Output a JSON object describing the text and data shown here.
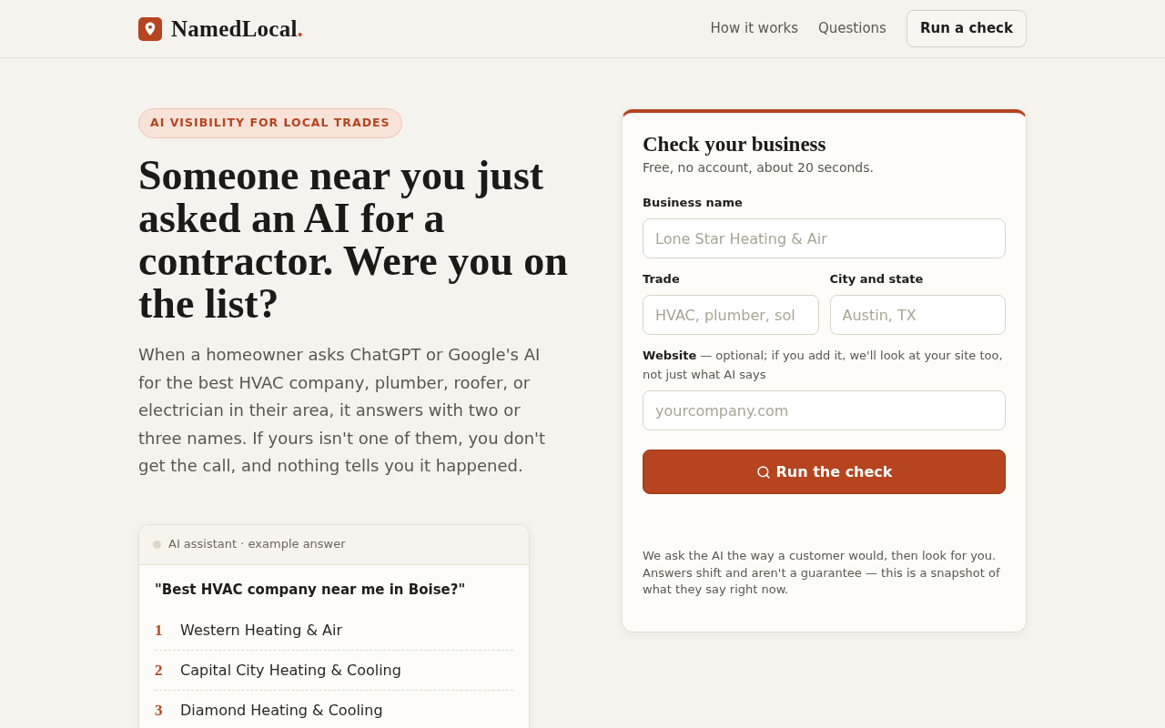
{
  "header": {
    "logo": {
      "name": "NamedLocal",
      "accent": "."
    },
    "nav": [
      {
        "label": "How it works"
      },
      {
        "label": "Questions"
      }
    ],
    "cta": "Run a check"
  },
  "hero": {
    "badge": "AI VISIBILITY FOR LOCAL TRADES",
    "title": "Someone near you just asked an AI for a contractor. Were you on the list?",
    "body": "When a homeowner asks ChatGPT or Google's AI for the best HVAC company, plumber, roofer, or electrician in their area, it answers with two or three names. If yours isn't one of them, you don't get the call, and nothing tells you it happened.",
    "example": {
      "header": "AI assistant · example answer",
      "question": "\"Best HVAC company near me in Boise?\"",
      "answers": [
        {
          "rank": "1",
          "name": "Western Heating & Air"
        },
        {
          "rank": "2",
          "name": "Capital City Heating & Cooling"
        },
        {
          "rank": "3",
          "name": "Diamond Heating & Cooling"
        }
      ]
    }
  },
  "form": {
    "title": "Check your business",
    "subtitle": "Free, no account, about 20 seconds.",
    "rows": [
      [
        {
          "label": "Business name",
          "placeholder": "Lone Star Heating & Air"
        }
      ],
      [
        {
          "label": "Trade",
          "placeholder": "HVAC, plumber, sol"
        },
        {
          "label": "City and state",
          "placeholder": "Austin, TX"
        }
      ],
      [
        {
          "label": "Website",
          "hint": "— optional; if you add it, we'll look at your site too, not just what AI says",
          "placeholder": "yourcompany.com"
        }
      ]
    ],
    "submit": "Run the check",
    "note": "We ask the AI the way a customer would, then look for you. Answers shift and aren't a guarantee — this is a snapshot of what they say right now."
  }
}
